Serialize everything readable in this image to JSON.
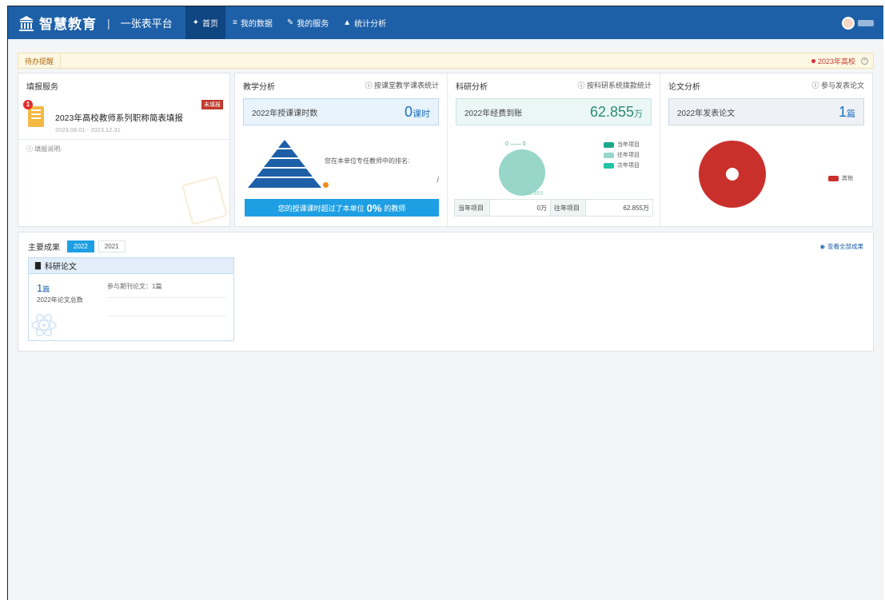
{
  "header": {
    "brand": "智慧教育",
    "separator": "|",
    "subtitle": "一张表平台",
    "nav": [
      {
        "label": "首页",
        "icon": "home-icon",
        "active": true
      },
      {
        "label": "我的数据",
        "icon": "database-icon",
        "active": false
      },
      {
        "label": "我的服务",
        "icon": "pencil-icon",
        "active": false
      },
      {
        "label": "统计分析",
        "icon": "area-chart-icon",
        "active": false
      }
    ]
  },
  "todo": {
    "label": "待办提醒",
    "item": "2023年高校"
  },
  "fill_service": {
    "title": "填报服务",
    "badge_count": "1",
    "item_title": "2023年高校教师系列职称简表填报",
    "item_dates": "2023.08.01 - 2023.12.31",
    "status_tag": "未填报",
    "desc_label": "填报说明:"
  },
  "teaching": {
    "title": "教学分析",
    "note": "按课堂教学课表统计",
    "stat_label": "2022年授课课时数",
    "stat_value": "0",
    "stat_unit": "课时",
    "rank_text": "您在本单位专任教师中的排名:",
    "rank_value": "/",
    "exceed_prefix": "您的授课课时超过了本单位",
    "exceed_percent": 0,
    "exceed_value": "0%",
    "exceed_suffix": "的教师"
  },
  "research": {
    "title": "科研分析",
    "note": "按科研系统拨款统计",
    "stat_label": "2022年经费到账",
    "stat_value": "62.855",
    "stat_unit": "万",
    "pie_labels": {
      "top": "0 —— 0",
      "bottom": "62.855"
    },
    "legend": [
      {
        "label": "当年项目",
        "color": "#1aa98a"
      },
      {
        "label": "往年项目",
        "color": "#97d6c8"
      },
      {
        "label": "次年项目",
        "color": "#22c4a6"
      }
    ],
    "chart_data": {
      "type": "pie",
      "categories": [
        "当年项目",
        "往年项目",
        "次年项目"
      ],
      "values": [
        0,
        62.855,
        0
      ]
    },
    "table": {
      "current_label": "当年项目",
      "current_value": "0万",
      "past_label": "往年项目",
      "past_value": "62.855万"
    }
  },
  "papers": {
    "title": "论文分析",
    "note": "参与发表论文",
    "stat_label": "2022年发表论文",
    "stat_value": "1",
    "stat_unit": "篇",
    "legend_label": "其他",
    "legend_color": "#c9302c",
    "chart_data": {
      "type": "pie",
      "categories": [
        "其他"
      ],
      "values": [
        1
      ]
    }
  },
  "achievements": {
    "title": "主要成果",
    "years": [
      "2022",
      "2021"
    ],
    "view_all": "查看全部成果",
    "card_title": "科研论文",
    "count": "1",
    "count_unit": "篇",
    "count_caption": "2022年论文总数",
    "journal_text": "参与期刊论文：1篇"
  }
}
